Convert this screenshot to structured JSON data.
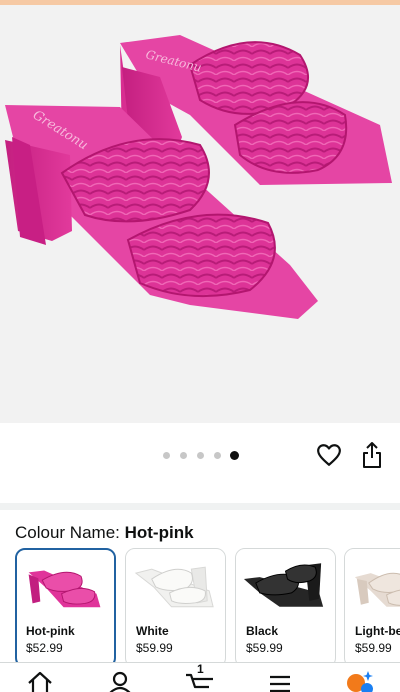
{
  "product": {
    "brand": "Greatonu",
    "carousel": {
      "count": 5,
      "active_index": 4
    }
  },
  "colour": {
    "label": "Colour Name:",
    "selected": "Hot-pink",
    "options": [
      {
        "name": "Hot-pink",
        "price": "$52.99",
        "swatch": "#e0349a"
      },
      {
        "name": "White",
        "price": "$59.99",
        "swatch": "#f4f4f2"
      },
      {
        "name": "Black",
        "price": "$59.99",
        "swatch": "#1e1e1e"
      },
      {
        "name": "Light-be",
        "price": "$59.99",
        "swatch": "#e8ddd4"
      }
    ]
  },
  "nav": {
    "cart_count": "1",
    "items": [
      "home-icon",
      "account-icon",
      "cart-icon",
      "menu-icon",
      "assistant-icon"
    ]
  },
  "colors": {
    "accent": "#2162a1",
    "product_pink": "#e0349a"
  }
}
